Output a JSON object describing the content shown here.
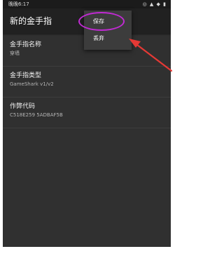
{
  "status_bar": {
    "time": "晚晚6:17",
    "icons": "◎ ▲ ◆ ▮"
  },
  "app_bar": {
    "title": "新的金手指"
  },
  "fields": [
    {
      "label": "金手指名称",
      "value": "穿墙"
    },
    {
      "label": "金手指类型",
      "value": "GameShark v1/v2"
    },
    {
      "label": "作弊代码",
      "value": "C518E259 5ADBAF5B"
    }
  ],
  "overflow_menu": {
    "items": [
      {
        "label": "保存"
      },
      {
        "label": "丢弃"
      }
    ]
  },
  "annotations": {
    "ellipse_color": "#c12ad3",
    "arrow_color": "#e53935"
  }
}
